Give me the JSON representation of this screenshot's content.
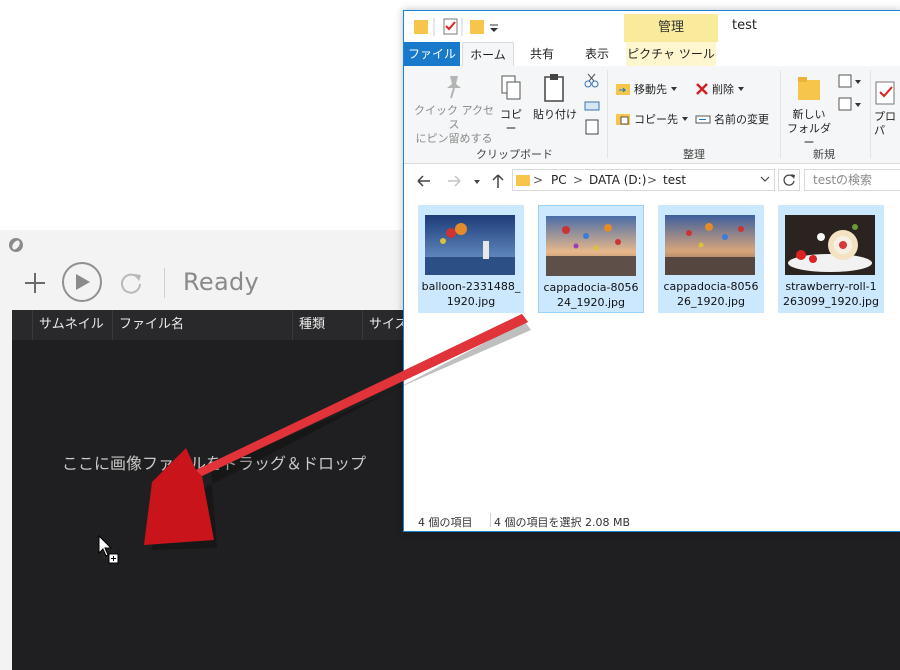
{
  "app": {
    "status": "Ready",
    "columns": [
      "サムネイル",
      "ファイル名",
      "種類",
      "サイズ"
    ],
    "drop_hint": "ここに画像ファイルをドラッグ＆ドロップ"
  },
  "explorer": {
    "window_title": "test",
    "context_tab_title": "管理",
    "tabs": {
      "file": "ファイル",
      "home": "ホーム",
      "share": "共有",
      "view": "表示",
      "picture_tools": "ピクチャ ツール"
    },
    "ribbon": {
      "quick_access_line1": "クイック アクセス",
      "quick_access_line2": "にピン留めする",
      "copy": "コピー",
      "paste": "貼り付け",
      "clipboard_group": "クリップボード",
      "move_to": "移動先",
      "copy_to": "コピー先",
      "delete": "削除",
      "rename": "名前の変更",
      "organize_group": "整理",
      "new_folder_line1": "新しい",
      "new_folder_line2": "フォルダー",
      "new_group": "新規",
      "properties": "プロパ"
    },
    "address": {
      "pc": "PC",
      "drive": "DATA (D:)",
      "folder": "test",
      "search_placeholder": "testの検索"
    },
    "files": [
      {
        "line1": "balloon-2331488_",
        "line2": "1920.jpg"
      },
      {
        "line1": "cappadocia-8056",
        "line2": "24_1920.jpg"
      },
      {
        "line1": "cappadocia-8056",
        "line2": "26_1920.jpg"
      },
      {
        "line1": "strawberry-roll-1",
        "line2": "263099_1920.jpg"
      }
    ],
    "status": {
      "item_count": "4 個の項目",
      "selection": "4 個の項目を選択  2.08 MB"
    }
  },
  "colors": {
    "accent_blue": "#1979ca",
    "selection": "#cce8ff",
    "context_tab": "#f8ec9c",
    "arrow_red": "#c8141a",
    "list_bg": "#1f1f21"
  }
}
